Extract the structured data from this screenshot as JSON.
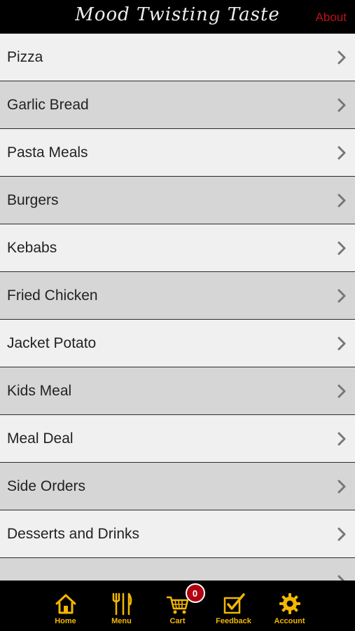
{
  "header": {
    "title": "Mood Twisting Taste",
    "about": "About"
  },
  "menu": {
    "items": [
      {
        "label": "Pizza"
      },
      {
        "label": "Garlic Bread"
      },
      {
        "label": "Pasta Meals"
      },
      {
        "label": "Burgers"
      },
      {
        "label": "Kebabs"
      },
      {
        "label": "Fried Chicken"
      },
      {
        "label": "Jacket Potato"
      },
      {
        "label": "Kids Meal"
      },
      {
        "label": "Meal Deal"
      },
      {
        "label": "Side Orders"
      },
      {
        "label": "Desserts and Drinks"
      },
      {
        "label": ""
      }
    ]
  },
  "tabbar": {
    "home": "Home",
    "menu": "Menu",
    "cart": "Cart",
    "cart_count": "0",
    "feedback": "Feedback",
    "account": "Account",
    "accent_color": "#f2b705"
  }
}
